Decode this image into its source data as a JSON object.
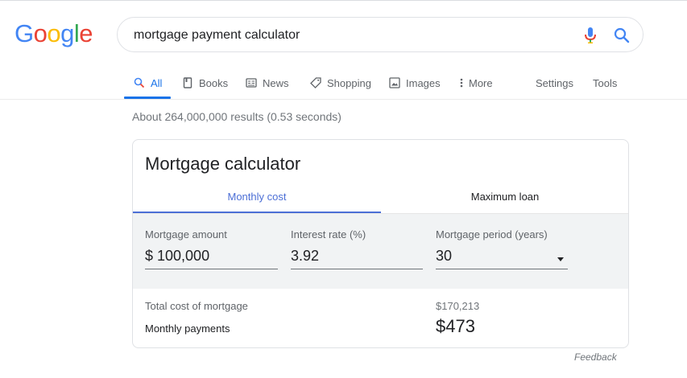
{
  "logo": {
    "letters": [
      "G",
      "o",
      "o",
      "g",
      "l",
      "e"
    ],
    "colors": [
      "#4285f4",
      "#ea4335",
      "#fbbc05",
      "#4285f4",
      "#34a853",
      "#ea4335"
    ]
  },
  "search": {
    "query": "mortgage payment calculator"
  },
  "icons": {
    "mic": "microphone-icon",
    "search": "search-icon"
  },
  "tabs": [
    {
      "label": "All",
      "icon": "search-icon",
      "active": true
    },
    {
      "label": "Books",
      "icon": "book-icon"
    },
    {
      "label": "News",
      "icon": "newspaper-icon"
    },
    {
      "label": "Shopping",
      "icon": "tag-icon"
    },
    {
      "label": "Images",
      "icon": "image-icon"
    },
    {
      "label": "More",
      "icon": "more-vert-icon"
    },
    {
      "label": "Settings"
    },
    {
      "label": "Tools"
    }
  ],
  "result_stats": "About 264,000,000 results (0.53 seconds)",
  "calculator": {
    "title": "Mortgage calculator",
    "tabs": {
      "monthly": "Monthly cost",
      "maximum": "Maximum loan"
    },
    "fields": {
      "amount_label": "Mortgage amount",
      "amount_value": "$ 100,000",
      "rate_label": "Interest rate (%)",
      "rate_value": "3.92",
      "period_label": "Mortgage period (years)",
      "period_value": "30"
    },
    "results": {
      "total_label": "Total cost of mortgage",
      "total_value": "$170,213",
      "monthly_label": "Monthly payments",
      "monthly_value": "$473"
    }
  },
  "feedback": "Feedback",
  "colors": {
    "accent": "#1a73e8",
    "calc_accent": "#4c6fd6"
  }
}
